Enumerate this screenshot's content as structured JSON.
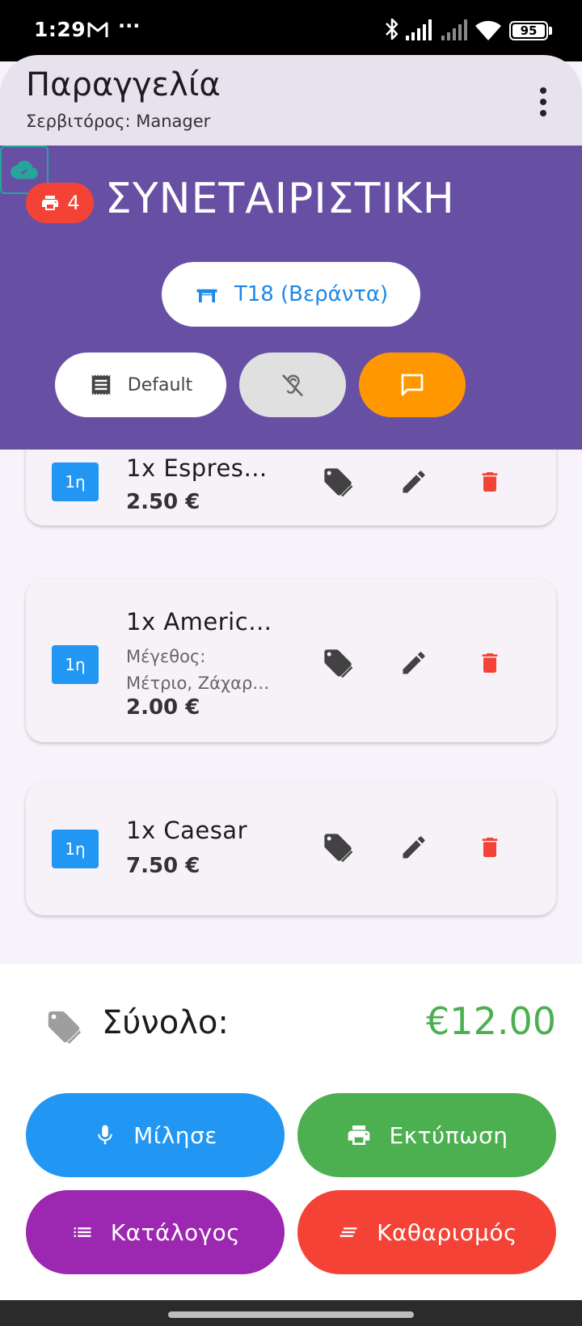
{
  "status_bar": {
    "time": "1:29",
    "dots": "···",
    "battery": "95",
    "icons": [
      "gmail-icon",
      "bluetooth-icon",
      "signal-icon",
      "signal-icon",
      "wifi-icon",
      "battery-icon"
    ]
  },
  "app_bar": {
    "title": "Παραγγελία",
    "subtitle": "Σερβιτόρος: Manager",
    "overflow_icon": "more-vert-icon"
  },
  "header": {
    "printer_count": "4",
    "shop_name": "ΣΥΝΕΤΑΙΡΙΣΤΙΚΗ",
    "table_label": "Τ18 (Βεράντα)",
    "price_list_label": "Default",
    "colors": {
      "background": "#6750a4",
      "badge": "#f44336",
      "message": "#ff9800",
      "cloud": "#26a69a"
    }
  },
  "order_items": [
    {
      "course": "1η",
      "name": "1x Espres…",
      "modifiers": "",
      "price": "2.50 €"
    },
    {
      "course": "1η",
      "name": "1x Americ…",
      "modifiers_line1": "Μέγεθος:",
      "modifiers_line2": "Μέτριο, Ζάχαρ…",
      "price": "2.00 €"
    },
    {
      "course": "1η",
      "name": "1x Caesar",
      "modifiers": "",
      "price": "7.50 €"
    }
  ],
  "totals": {
    "label": "Σύνολο:",
    "value": "€12.00",
    "value_color": "#4caf50"
  },
  "actions": {
    "speak": "Μίλησε",
    "print": "Εκτύπωση",
    "catalog": "Κατάλογος",
    "clear": "Καθαρισμός"
  }
}
